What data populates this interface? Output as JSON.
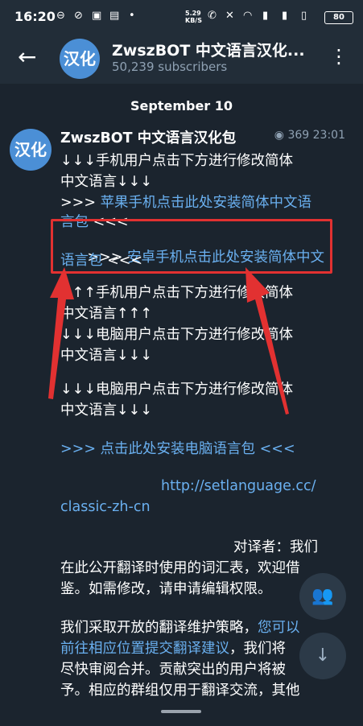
{
  "status": {
    "time": "16:20",
    "speed": "5.29\nKB/S",
    "battery": "80"
  },
  "header": {
    "title": "ZwszBOT 中文语言汉化...",
    "subscribers": "50,239 subscribers",
    "avatar_text": "汉化"
  },
  "date_label": "September 10",
  "message": {
    "sender": "ZwszBOT 中文语言汉化包",
    "views": "369",
    "time": "23:01",
    "avatar_text": "汉化",
    "lines": [
      "↓↓↓手机用户点击下方进行修改简体",
      "中文语言↓↓↓",
      ">>> ",
      "苹果手机点击此处安装简体中文语",
      "言包",
      " <<<",
      "    >>> ",
      "安卓手机点击此处安装简体中文",
      "语言包",
      " <<<",
      "↑↑↑手机用户点击下方进行修改简体",
      "中文语言↑↑↑",
      "↓↓↓电脑用户点击下方进行修改简体",
      "中文语言↓↓↓",
      "↓↓↓电脑用户点击下方进行修改简体",
      "中文语言↓↓↓",
      ">>> 点击此处安装电脑语言包 <<<",
      "http://setlanguage.cc/",
      "classic-zh-cn",
      "对译者：我们",
      "在此公开翻译时使用的词汇表，欢迎借",
      "鉴。如需修改，请申请编辑权限。",
      "我们采取开放的翻译维护策略，",
      "您可以",
      "前往相应位置提交翻译建议",
      "，我们将",
      "尽快审阅合并。贡献突出的用户将被",
      "予。相应的群组仅用于翻译交流，其他"
    ]
  }
}
